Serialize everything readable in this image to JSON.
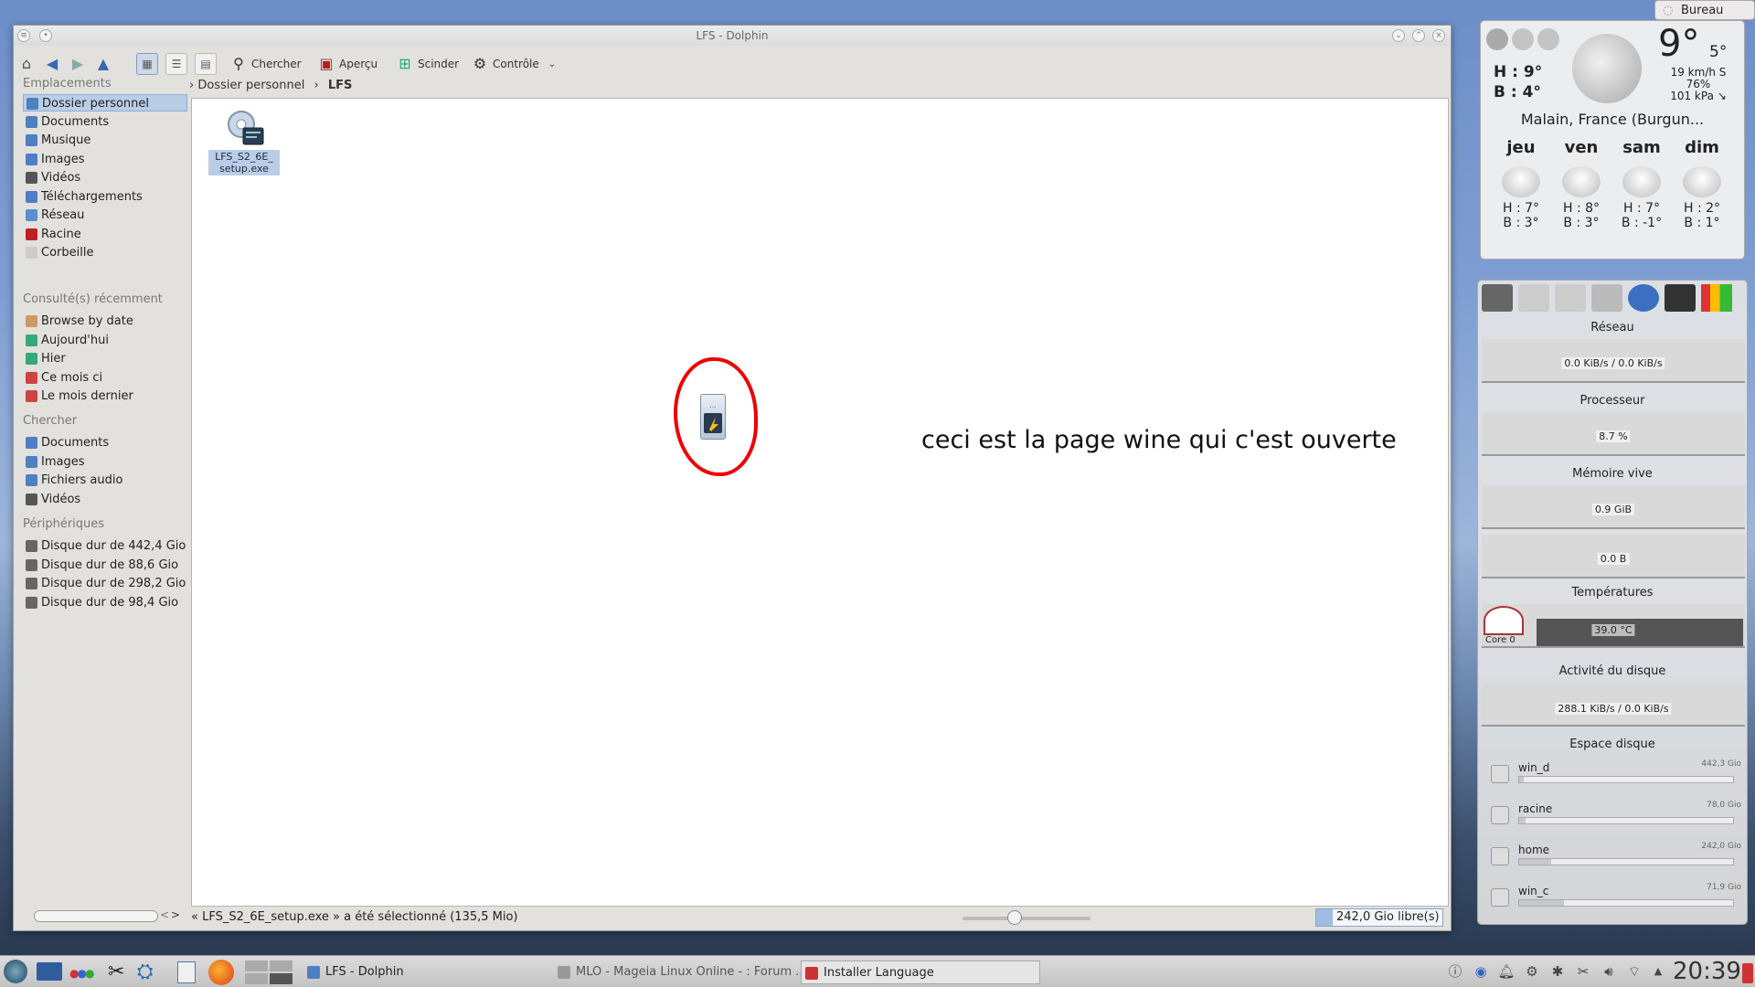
{
  "window": {
    "title": "LFS - Dolphin",
    "toolbar": {
      "search": "Chercher",
      "preview": "Aperçu",
      "split": "Scinder",
      "control": "Contrôle"
    },
    "sidebar": {
      "places_title": "Emplacements",
      "places": [
        "Dossier personnel",
        "Documents",
        "Musique",
        "Images",
        "Vidéos",
        "Téléchargements",
        "Réseau",
        "Racine",
        "Corbeille"
      ],
      "recent_title": "Consulté(s) récemment",
      "recent": [
        "Browse by date",
        "Aujourd'hui",
        "Hier",
        "Ce mois ci",
        "Le mois dernier"
      ],
      "search_title": "Chercher",
      "search": [
        "Documents",
        "Images",
        "Fichiers audio",
        "Vidéos"
      ],
      "devices_title": "Périphériques",
      "devices": [
        "Disque dur de 442,4 Gio",
        "Disque dur de 88,6 Gio",
        "Disque dur de 298,2 Gio",
        "Disque dur de 98,4 Gio"
      ]
    },
    "breadcrumb": {
      "home": "Dossier personnel",
      "current": "LFS"
    },
    "file": {
      "name_line1": "LFS_S2_6E_",
      "name_line2": "setup.exe"
    },
    "annotation": "ceci est la page wine qui c'est ouverte",
    "status": "« LFS_S2_6E_setup.exe » a été sélectionné (135,5 Mio)",
    "free_space": "242,0 Gio libre(s)",
    "free_fraction": 0.08
  },
  "desktop": {
    "bureau": "Bureau"
  },
  "weather": {
    "temp": "9°",
    "temp_small": "5°",
    "high": "H : 9°",
    "low": "B : 4°",
    "wind": "19 km/h S",
    "humidity": "76%",
    "pressure": "101 kPa ↘",
    "location": "Malain, France (Burgun...",
    "days": [
      {
        "d": "jeu",
        "h": "H : 7°",
        "b": "B : 3°"
      },
      {
        "d": "ven",
        "h": "H : 8°",
        "b": "B : 3°"
      },
      {
        "d": "sam",
        "h": "H : 7°",
        "b": "B : -1°"
      },
      {
        "d": "dim",
        "h": "H : 2°",
        "b": "B : 1°"
      }
    ]
  },
  "sysmon": {
    "network_title": "Réseau",
    "network_val": "0.0 KiB/s / 0.0 KiB/s",
    "cpu_title": "Processeur",
    "cpu_val": "8.7 %",
    "mem_title": "Mémoire vive",
    "mem_val": "0.9 GiB",
    "swap_val": "0.0 B",
    "temp_title": "Températures",
    "temp_core": "Core 0",
    "temp_val": "39.0 °C",
    "disk_title": "Activité du disque",
    "disk_val": "288.1 KiB/s / 0.0 KiB/s",
    "space_title": "Espace disque",
    "disks": [
      {
        "n": "win_d",
        "s": "442,3 Gio",
        "f": 0.02
      },
      {
        "n": "racine",
        "s": "78,0 Gio",
        "f": 0.03
      },
      {
        "n": "home",
        "s": "242,0 Gio",
        "f": 0.15
      },
      {
        "n": "win_c",
        "s": "71,9 Gio",
        "f": 0.21
      }
    ]
  },
  "taskbar": {
    "tasks": [
      "LFS - Dolphin",
      "MLO - Mageia Linux Online - : Forum ...",
      "Installer Language"
    ],
    "clock": "20:39"
  }
}
